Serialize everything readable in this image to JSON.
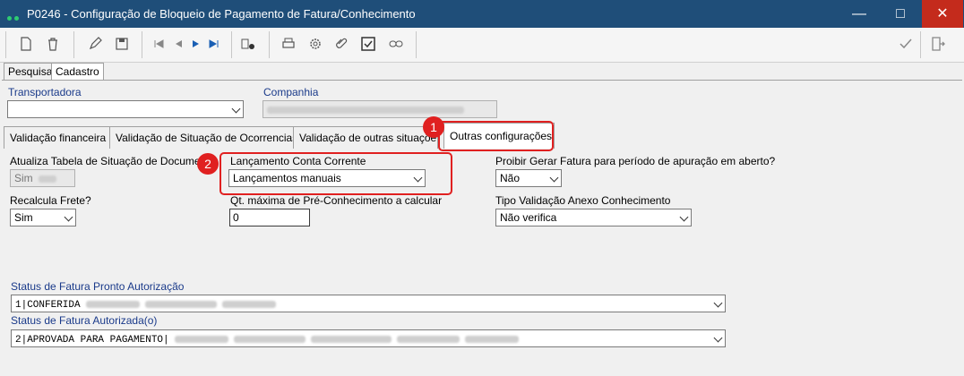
{
  "window": {
    "title": "P0246 - Configuração de Bloqueio de Pagamento de Fatura/Conhecimento"
  },
  "main_tabs": [
    {
      "label": "Pesquisa"
    },
    {
      "label": "Cadastro"
    }
  ],
  "fields": {
    "transportadora": {
      "label": "Transportadora",
      "value": ""
    },
    "companhia": {
      "label": "Companhia"
    }
  },
  "sub_tabs": [
    {
      "label": "Validação financeira"
    },
    {
      "label": "Validação de Situação de Ocorrencias"
    },
    {
      "label": "Validação de outras situaçõe"
    },
    {
      "label": "Outras configurações"
    }
  ],
  "form": {
    "atualiza_tabela": {
      "label": "Atualiza Tabela de Situação de Documento",
      "value": "Sim"
    },
    "lancamento_conta": {
      "label": "Lançamento Conta Corrente",
      "value": "Lançamentos manuais"
    },
    "proibir_gerar": {
      "label": "Proibir Gerar Fatura para período de apuração em aberto?",
      "value": "Não"
    },
    "recalcula_frete": {
      "label": "Recalcula Frete?",
      "value": "Sim"
    },
    "qt_maxima": {
      "label": "Qt. máxima de Pré-Conhecimento a calcular",
      "value": "0"
    },
    "tipo_validacao": {
      "label": "Tipo Validação Anexo Conhecimento",
      "value": "Não verifica"
    },
    "status_pronto": {
      "label": "Status de Fatura Pronto Autorização",
      "value": "1|CONFERIDA"
    },
    "status_autorizada": {
      "label": "Status de Fatura Autorizada(o)",
      "value": "2|APROVADA PARA PAGAMENTO|"
    }
  },
  "callouts": [
    {
      "number": "1"
    },
    {
      "number": "2"
    }
  ],
  "colors": {
    "titlebar": "#1f4e79",
    "callout": "#e02020",
    "label": "#1a3a8a"
  }
}
